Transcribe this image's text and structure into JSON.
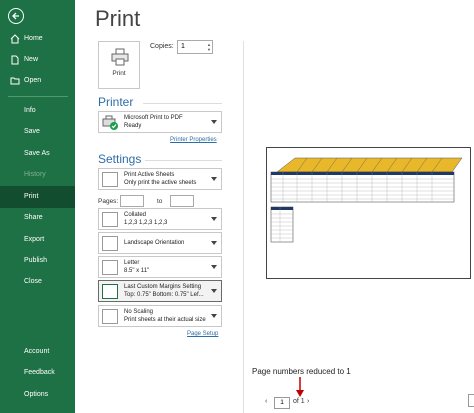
{
  "sidebar": {
    "items": [
      {
        "label": "Home"
      },
      {
        "label": "New"
      },
      {
        "label": "Open"
      },
      {
        "label": "Info"
      },
      {
        "label": "Save"
      },
      {
        "label": "Save As"
      },
      {
        "label": "History"
      },
      {
        "label": "Print"
      },
      {
        "label": "Share"
      },
      {
        "label": "Export"
      },
      {
        "label": "Publish"
      },
      {
        "label": "Close"
      },
      {
        "label": "Account"
      },
      {
        "label": "Feedback"
      },
      {
        "label": "Options"
      }
    ]
  },
  "main": {
    "title": "Print",
    "print_button_label": "Print",
    "copies_label": "Copies:",
    "copies_value": "1",
    "printer_section": "Printer",
    "printer_name": "Microsoft Print to PDF",
    "printer_status": "Ready",
    "printer_properties_link": "Printer Properties",
    "settings_section": "Settings",
    "settings": {
      "sheets_title": "Print Active Sheets",
      "sheets_sub": "Only print the active sheets",
      "pages_label": "Pages:",
      "to_label": "to",
      "collated_title": "Collated",
      "collated_sub": "1,2,3   1,2,3   1,2,3",
      "orientation": "Landscape Orientation",
      "paper_title": "Letter",
      "paper_sub": "8.5\" x 11\"",
      "margins_title": "Last Custom Margins Setting",
      "margins_sub": "Top: 0.75\" Bottom: 0.75\" Lef...",
      "scaling_title": "No Scaling",
      "scaling_sub": "Print sheets at their actual size",
      "page_setup_link": "Page Setup"
    },
    "preview": {
      "note": "Page numbers reduced to 1",
      "current_page": "1",
      "of_label": "of 1"
    }
  },
  "colors": {
    "sidebar": "#1e7145",
    "active": "#134d2f",
    "accent": "#2e6ea6",
    "red_arrow": "#c00000"
  }
}
